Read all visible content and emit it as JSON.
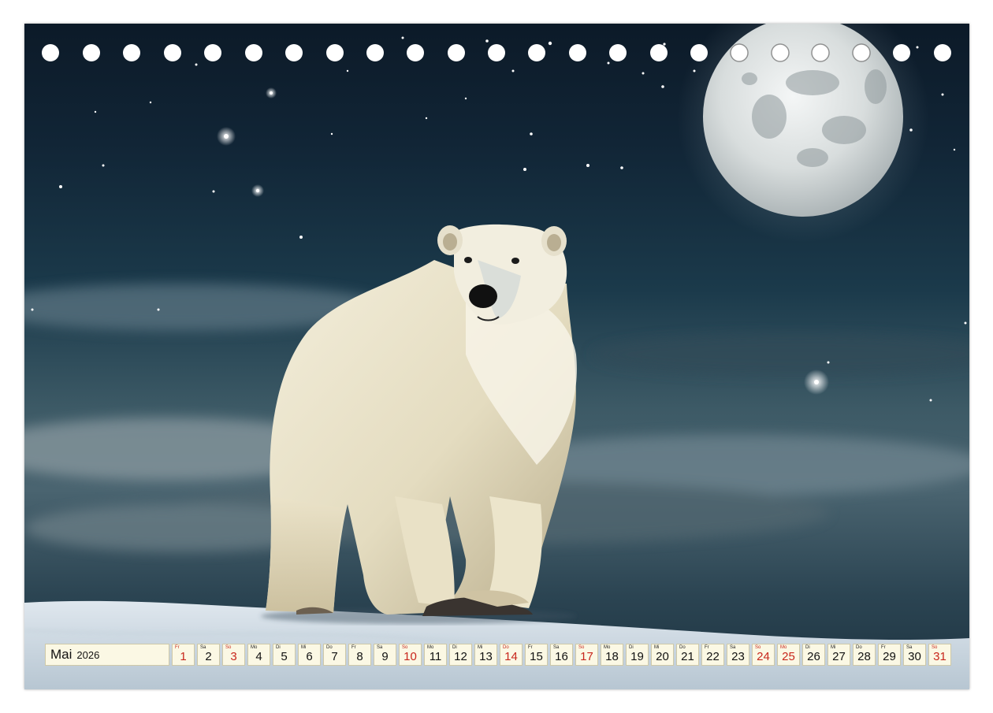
{
  "calendar": {
    "month": "Mai",
    "year": "2026",
    "holiday_color": "#c8261c",
    "days": [
      {
        "wd": "Fr",
        "d": "1",
        "red": true
      },
      {
        "wd": "Sa",
        "d": "2",
        "red": false
      },
      {
        "wd": "So",
        "d": "3",
        "red": true
      },
      {
        "wd": "Mo",
        "d": "4",
        "red": false
      },
      {
        "wd": "Di",
        "d": "5",
        "red": false
      },
      {
        "wd": "Mi",
        "d": "6",
        "red": false
      },
      {
        "wd": "Do",
        "d": "7",
        "red": false
      },
      {
        "wd": "Fr",
        "d": "8",
        "red": false
      },
      {
        "wd": "Sa",
        "d": "9",
        "red": false
      },
      {
        "wd": "So",
        "d": "10",
        "red": true
      },
      {
        "wd": "Mo",
        "d": "11",
        "red": false
      },
      {
        "wd": "Di",
        "d": "12",
        "red": false
      },
      {
        "wd": "Mi",
        "d": "13",
        "red": false
      },
      {
        "wd": "Do",
        "d": "14",
        "red": true
      },
      {
        "wd": "Fr",
        "d": "15",
        "red": false
      },
      {
        "wd": "Sa",
        "d": "16",
        "red": false
      },
      {
        "wd": "So",
        "d": "17",
        "red": true
      },
      {
        "wd": "Mo",
        "d": "18",
        "red": false
      },
      {
        "wd": "Di",
        "d": "19",
        "red": false
      },
      {
        "wd": "Mi",
        "d": "20",
        "red": false
      },
      {
        "wd": "Do",
        "d": "21",
        "red": false
      },
      {
        "wd": "Fr",
        "d": "22",
        "red": false
      },
      {
        "wd": "Sa",
        "d": "23",
        "red": false
      },
      {
        "wd": "So",
        "d": "24",
        "red": true
      },
      {
        "wd": "Mo",
        "d": "25",
        "red": true
      },
      {
        "wd": "Di",
        "d": "26",
        "red": false
      },
      {
        "wd": "Mi",
        "d": "27",
        "red": false
      },
      {
        "wd": "Do",
        "d": "28",
        "red": false
      },
      {
        "wd": "Fr",
        "d": "29",
        "red": false
      },
      {
        "wd": "Sa",
        "d": "30",
        "red": false
      },
      {
        "wd": "So",
        "d": "31",
        "red": true
      }
    ]
  },
  "artwork": {
    "subjects": [
      "polar-bear",
      "full-moon",
      "starry-night-sky",
      "snow-ground",
      "clouds"
    ]
  }
}
